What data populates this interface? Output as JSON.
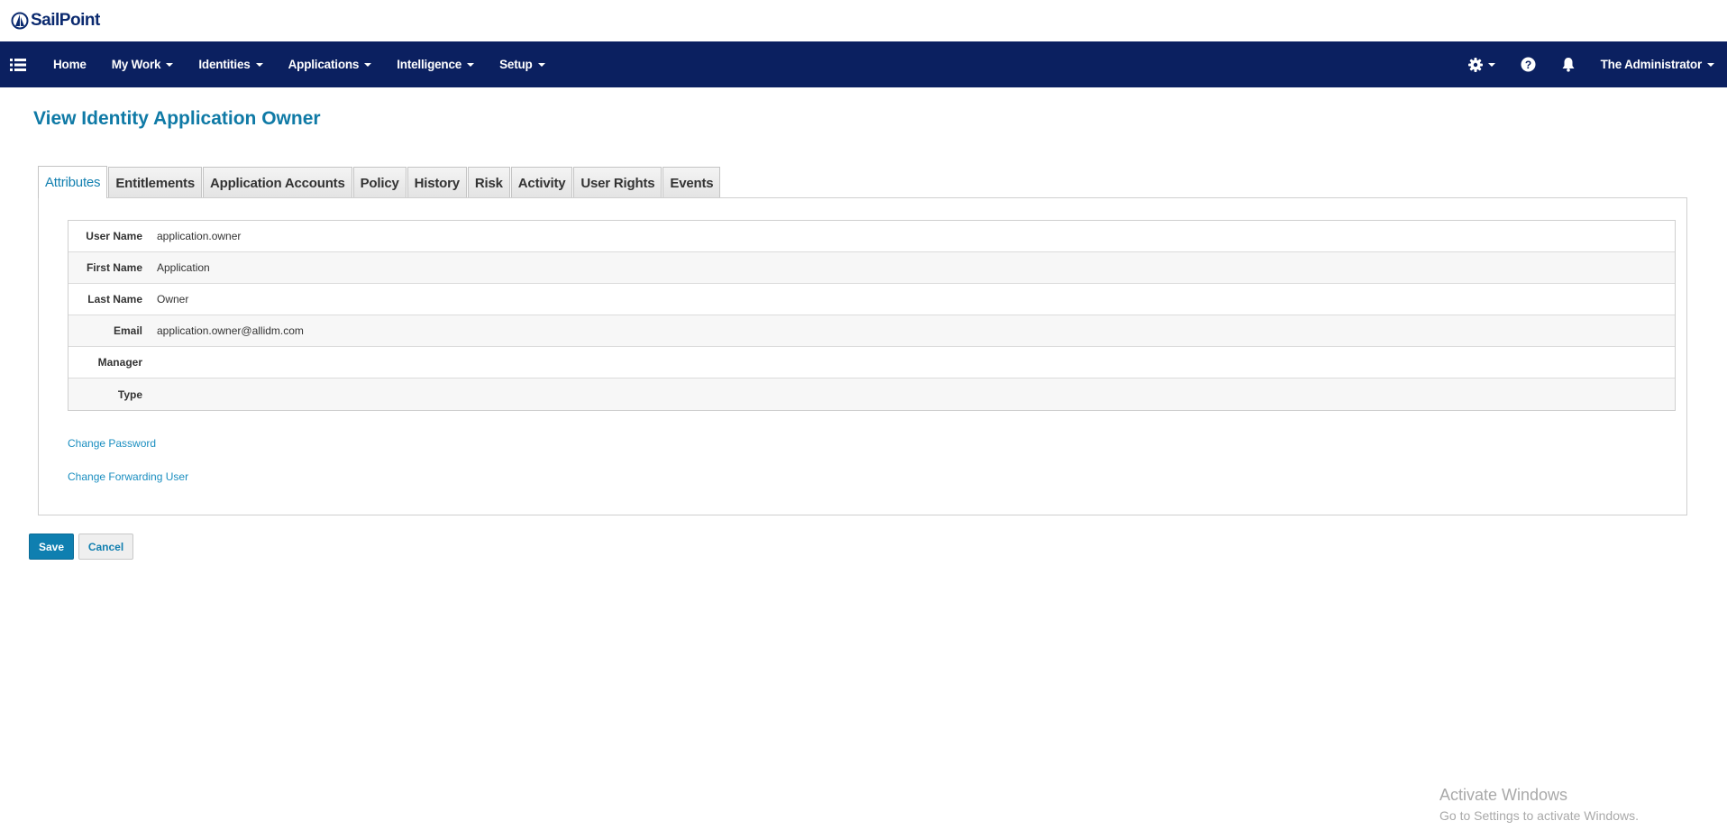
{
  "brand": {
    "logo_text": "SailPoint"
  },
  "nav": {
    "items": [
      {
        "label": "Home",
        "has_menu": false
      },
      {
        "label": "My Work",
        "has_menu": true
      },
      {
        "label": "Identities",
        "has_menu": true
      },
      {
        "label": "Applications",
        "has_menu": true
      },
      {
        "label": "Intelligence",
        "has_menu": true
      },
      {
        "label": "Setup",
        "has_menu": true
      }
    ],
    "user": "The Administrator",
    "icons": [
      "list-icon",
      "gear-icon",
      "help-icon",
      "bell-icon"
    ]
  },
  "page": {
    "title": "View Identity Application Owner"
  },
  "tabs": [
    {
      "label": "Attributes",
      "active": true
    },
    {
      "label": "Entitlements",
      "active": false
    },
    {
      "label": "Application Accounts",
      "active": false
    },
    {
      "label": "Policy",
      "active": false
    },
    {
      "label": "History",
      "active": false
    },
    {
      "label": "Risk",
      "active": false
    },
    {
      "label": "Activity",
      "active": false
    },
    {
      "label": "User Rights",
      "active": false
    },
    {
      "label": "Events",
      "active": false
    }
  ],
  "attributes": [
    {
      "label": "User Name",
      "value": "application.owner"
    },
    {
      "label": "First Name",
      "value": "Application"
    },
    {
      "label": "Last Name",
      "value": "Owner"
    },
    {
      "label": "Email",
      "value": "application.owner@allidm.com"
    },
    {
      "label": "Manager",
      "value": ""
    },
    {
      "label": "Type",
      "value": ""
    }
  ],
  "links": {
    "change_password": "Change Password",
    "change_forwarding_user": "Change Forwarding User"
  },
  "buttons": {
    "save": "Save",
    "cancel": "Cancel"
  },
  "watermark": {
    "title": "Activate Windows",
    "subtitle": "Go to Settings to activate Windows."
  },
  "colors": {
    "navbar": "#0b2060",
    "accent": "#0f7aa6",
    "link": "#1a8ec0"
  }
}
